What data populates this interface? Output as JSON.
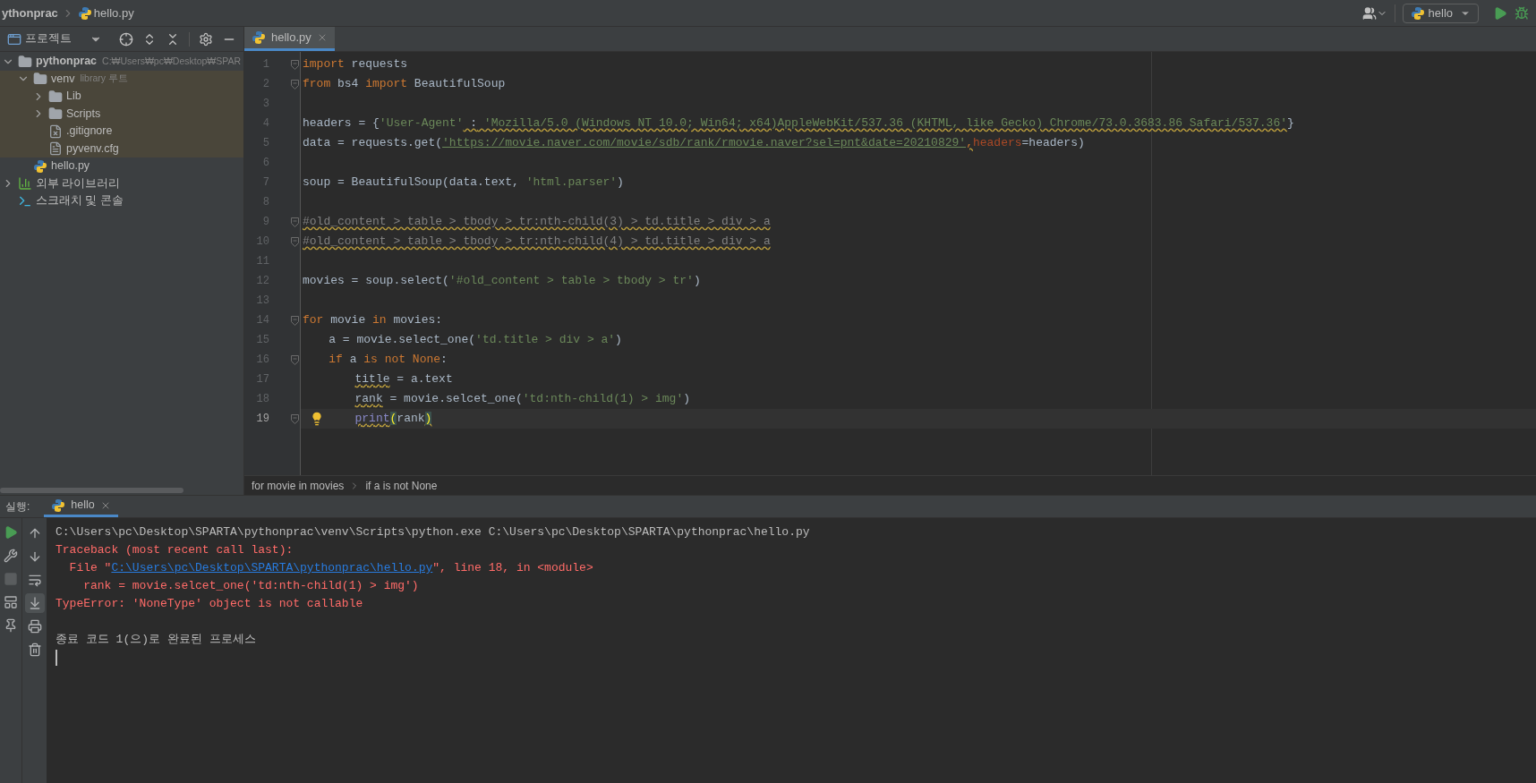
{
  "navigation_bar": {
    "breadcrumbs": [
      {
        "label": "ythonprac",
        "kind": "project"
      },
      {
        "label": "hello.py",
        "kind": "python-file"
      }
    ],
    "run_configuration": "hello"
  },
  "project_panel": {
    "title": "프로젝트",
    "tree": [
      {
        "label": "pythonprac",
        "detail": "C:₩Users₩pc₩Desktop₩SPAR",
        "kind": "project",
        "expanded": true,
        "children": [
          {
            "label": "venv",
            "detail": "library 루트",
            "kind": "folder",
            "expanded": true,
            "highlighted": true,
            "children": [
              {
                "label": "Lib",
                "kind": "folder",
                "expanded": false
              },
              {
                "label": "Scripts",
                "kind": "folder",
                "expanded": false
              },
              {
                "label": ".gitignore",
                "kind": "ignore-file"
              },
              {
                "label": "pyvenv.cfg",
                "kind": "config-file"
              }
            ]
          },
          {
            "label": "hello.py",
            "kind": "python-file"
          }
        ]
      },
      {
        "label": "외부 라이브러리",
        "kind": "libraries",
        "expanded": false
      },
      {
        "label": "스크래치 및 콘솔",
        "kind": "scratches"
      }
    ]
  },
  "editor": {
    "tabs": [
      {
        "label": "hello.py",
        "selected": true
      }
    ],
    "lines": [
      {
        "number": "1",
        "fold_marker": true,
        "tokens": [
          {
            "text": "import",
            "kind": "keyword"
          },
          {
            "text": " requests",
            "kind": "plain"
          }
        ]
      },
      {
        "number": "2",
        "fold_marker": true,
        "tokens": [
          {
            "text": "from",
            "kind": "keyword"
          },
          {
            "text": " bs4 ",
            "kind": "plain"
          },
          {
            "text": "import",
            "kind": "keyword"
          },
          {
            "text": " BeautifulSoup",
            "kind": "plain"
          }
        ]
      },
      {
        "number": "3"
      },
      {
        "number": "4",
        "tokens": [
          {
            "text": "headers = {",
            "kind": "plain"
          },
          {
            "text": "'User-Agent'",
            "kind": "string"
          },
          {
            "text": " :",
            "kind": "plain",
            "warning": true
          },
          {
            "text": " 'Mozilla/5.0 (Windows NT 10.0; Win64; x64)AppleWebKit/537.36 (KHTML, like Gecko) Chrome/73.0.3683.86 Safari/537.36'",
            "kind": "string",
            "warning": true
          },
          {
            "text": "}",
            "kind": "plain"
          }
        ]
      },
      {
        "number": "5",
        "tokens": [
          {
            "text": "data = requests.get(",
            "kind": "plain"
          },
          {
            "text": "'https://movie.naver.com/movie/sdb/rank/rmovie.naver?sel=pnt&date=20210829'",
            "kind": "url"
          },
          {
            "text": ",",
            "kind": "keyword",
            "warning": true
          },
          {
            "text": "headers",
            "kind": "parameter"
          },
          {
            "text": "=headers)",
            "kind": "plain"
          }
        ]
      },
      {
        "number": "6"
      },
      {
        "number": "7",
        "tokens": [
          {
            "text": "soup = BeautifulSoup(data.text, ",
            "kind": "plain"
          },
          {
            "text": "'html.parser'",
            "kind": "string"
          },
          {
            "text": ")",
            "kind": "plain"
          }
        ]
      },
      {
        "number": "8"
      },
      {
        "number": "9",
        "fold_marker": true,
        "tokens": [
          {
            "text": "#old_content > table > tbody > tr:nth-child(3) > td.title > div > a",
            "kind": "comment",
            "warning": true
          }
        ]
      },
      {
        "number": "10",
        "fold_marker": true,
        "tokens": [
          {
            "text": "#old_content > table > tbody > tr:nth-child(4) > td.title > div > a",
            "kind": "comment",
            "warning": true
          }
        ]
      },
      {
        "number": "11"
      },
      {
        "number": "12",
        "tokens": [
          {
            "text": "movies = soup.select(",
            "kind": "plain"
          },
          {
            "text": "'#old_content > table > tbody > tr'",
            "kind": "string"
          },
          {
            "text": ")",
            "kind": "plain"
          }
        ]
      },
      {
        "number": "13"
      },
      {
        "number": "14",
        "fold_marker": true,
        "tokens": [
          {
            "text": "for",
            "kind": "keyword"
          },
          {
            "text": " movie ",
            "kind": "plain"
          },
          {
            "text": "in",
            "kind": "keyword"
          },
          {
            "text": " movies:",
            "kind": "plain"
          }
        ],
        "children": [
          {
            "number": "15",
            "tokens": [
              {
                "text": "a = movie.select_one(",
                "kind": "plain"
              },
              {
                "text": "'td.title > div > a'",
                "kind": "string"
              },
              {
                "text": ")",
                "kind": "plain"
              }
            ]
          },
          {
            "number": "16",
            "fold_marker": true,
            "tokens": [
              {
                "text": "if",
                "kind": "keyword"
              },
              {
                "text": " a ",
                "kind": "plain"
              },
              {
                "text": "is not None",
                "kind": "keyword"
              },
              {
                "text": ":",
                "kind": "plain"
              }
            ],
            "children": [
              {
                "number": "17",
                "tokens": [
                  {
                    "text": "title",
                    "kind": "plain",
                    "warning": true
                  },
                  {
                    "text": " = a.text",
                    "kind": "plain"
                  }
                ]
              },
              {
                "number": "18",
                "tokens": [
                  {
                    "text": "rank",
                    "kind": "plain",
                    "warning": true
                  },
                  {
                    "text": " = movie.selcet_one(",
                    "kind": "plain"
                  },
                  {
                    "text": "'td:nth-child(1) > img'",
                    "kind": "string"
                  },
                  {
                    "text": ")",
                    "kind": "plain"
                  }
                ]
              },
              {
                "number": "19",
                "fold_marker": true,
                "current": true,
                "bulb": true,
                "tokens": [
                  {
                    "text": "print",
                    "kind": "builtin",
                    "warning": true
                  },
                  {
                    "text": "(",
                    "kind": "brace"
                  },
                  {
                    "text": "rank",
                    "kind": "plain"
                  },
                  {
                    "text": ")",
                    "kind": "brace",
                    "warning": true
                  }
                ]
              }
            ]
          }
        ]
      }
    ],
    "breadcrumbs": [
      "for movie in movies",
      "if a is not None"
    ]
  },
  "run_panel": {
    "label": "실행:",
    "tabs": [
      {
        "label": "hello",
        "selected": true
      }
    ],
    "console": [
      {
        "kind": "command",
        "parts": [
          {
            "text": "C:\\Users\\pc\\Desktop\\SPARTA\\pythonprac\\venv\\Scripts\\python.exe C:\\Users\\pc\\Desktop\\SPARTA\\pythonprac\\hello.py"
          }
        ]
      },
      {
        "kind": "error",
        "parts": [
          {
            "text": "Traceback (most recent call last):"
          }
        ]
      },
      {
        "kind": "error",
        "parts": [
          {
            "text": "  File \""
          },
          {
            "text": "C:\\Users\\pc\\Desktop\\SPARTA\\pythonprac\\hello.py",
            "link": true
          },
          {
            "text": "\", line 18, in <module>"
          }
        ]
      },
      {
        "kind": "error",
        "parts": [
          {
            "text": "    rank = movie.selcet_one('td:nth-child(1) > img')"
          }
        ]
      },
      {
        "kind": "error",
        "parts": [
          {
            "text": "TypeError: 'NoneType' object is not callable"
          }
        ]
      },
      {
        "kind": "status",
        "parts": [
          {
            "text": "종료 코드 1(으)로 완료된 프로세스"
          }
        ]
      }
    ],
    "tools": [
      {
        "kind": "up",
        "selected": false
      },
      {
        "kind": "down",
        "selected": false
      },
      {
        "kind": "wrap",
        "selected": false
      },
      {
        "kind": "scroll-end",
        "selected": true
      },
      {
        "kind": "print",
        "selected": false
      },
      {
        "kind": "trash",
        "selected": false
      }
    ]
  }
}
